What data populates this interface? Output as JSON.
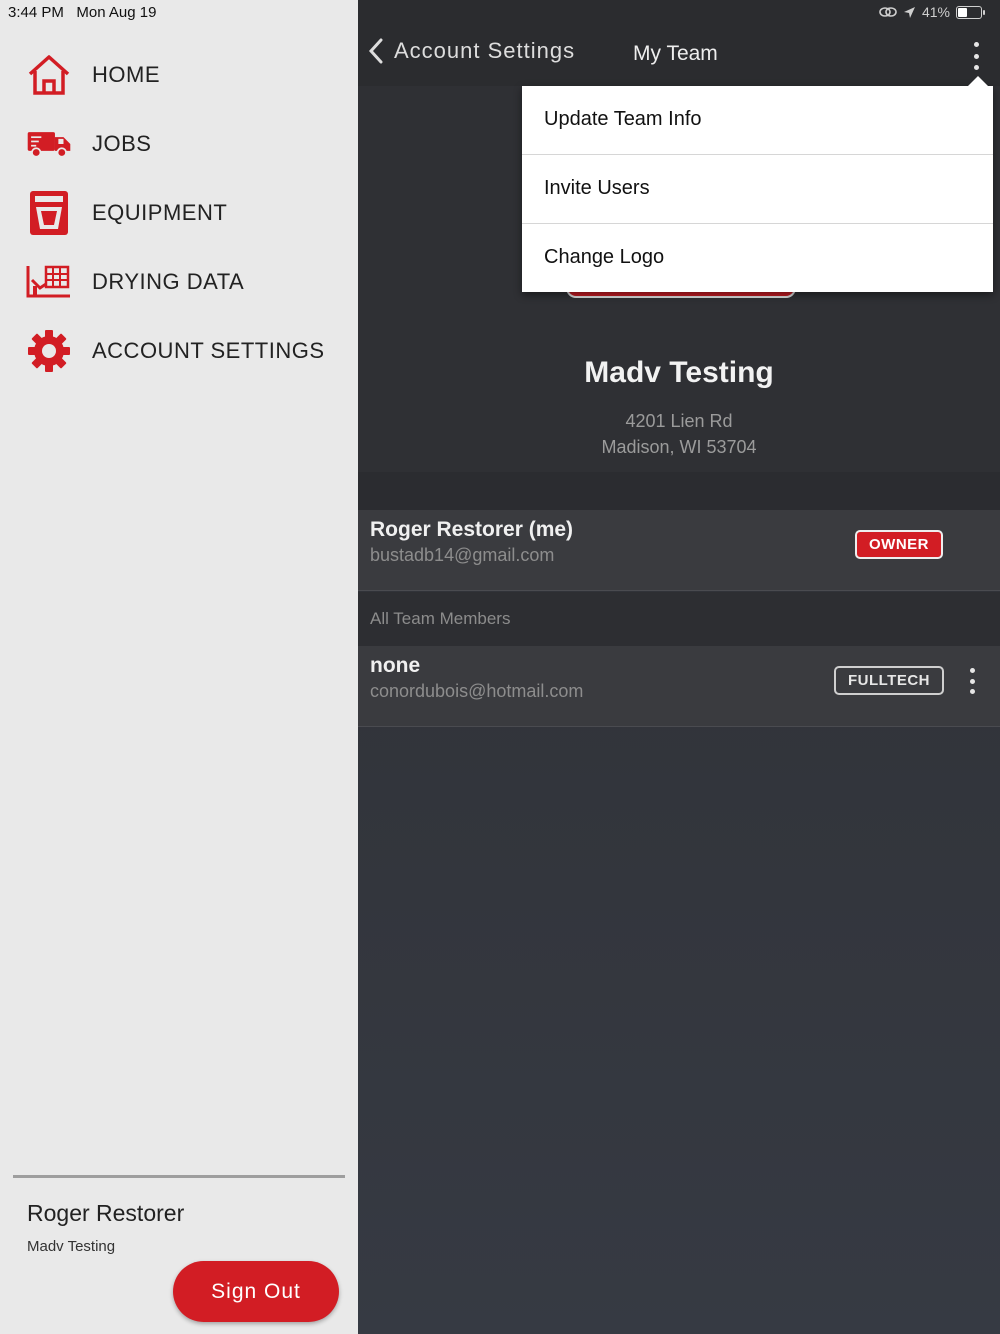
{
  "status_bar": {
    "time": "3:44 PM",
    "date": "Mon Aug 19",
    "battery": "41%",
    "battery_level": 0.41
  },
  "sidebar": {
    "items": [
      {
        "label": "HOME",
        "icon": "home-icon"
      },
      {
        "label": "JOBS",
        "icon": "truck-icon"
      },
      {
        "label": "EQUIPMENT",
        "icon": "equipment-icon"
      },
      {
        "label": "DRYING DATA",
        "icon": "drying-data-icon"
      },
      {
        "label": "ACCOUNT SETTINGS",
        "icon": "gear-icon"
      }
    ],
    "user_name": "Roger Restorer",
    "team_name": "Madv Testing",
    "sign_out_label": "Sign Out"
  },
  "header": {
    "back_label": "Account Settings",
    "title": "My Team"
  },
  "team": {
    "name": "Madv Testing",
    "address_line1": "4201 Lien Rd",
    "address_line2": "Madison, WI 53704"
  },
  "owner": {
    "name": "Roger Restorer (me)",
    "email": "bustadb14@gmail.com",
    "role": "OWNER"
  },
  "members_section_label": "All Team Members",
  "members": [
    {
      "name": "none",
      "email": "conordubois@hotmail.com",
      "role": "FULLTECH"
    }
  ],
  "menu": {
    "items": [
      "Update Team Info",
      "Invite Users",
      "Change Logo"
    ]
  },
  "colors": {
    "accent": "#d21d24",
    "sidebar_bg": "#e9e9e9",
    "main_bg": "#2e2f33"
  }
}
